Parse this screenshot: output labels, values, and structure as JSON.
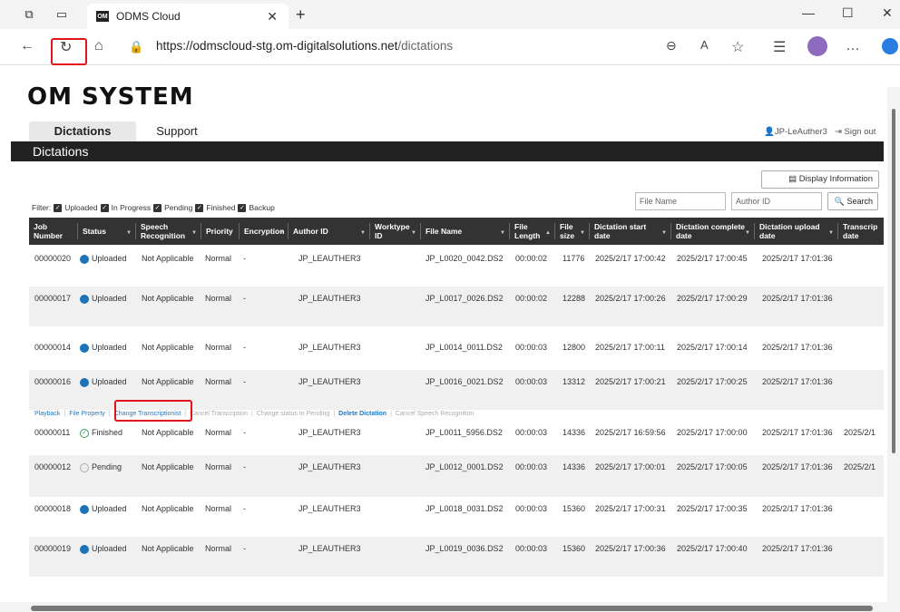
{
  "browser": {
    "tab_title": "ODMS Cloud",
    "favicon_text": "OM",
    "url_host": "https://odmscloud-stg.om-digitalsolutions.net",
    "url_path": "/dictations"
  },
  "app": {
    "logo": "OM SYSTEM",
    "nav_tabs": [
      "Dictations",
      "Support"
    ],
    "user": "JP-LeAuther3",
    "sign_out": "Sign out",
    "section_title": "Dictations",
    "display_info_label": "Display Information",
    "filter_label": "Filter:",
    "filters": [
      "Uploaded",
      "In Progress",
      "Pending",
      "Finished",
      "Backup"
    ],
    "file_name_placeholder": "File Name",
    "author_id_placeholder": "Author ID",
    "search_label": "Search"
  },
  "table": {
    "columns": [
      "Job Number",
      "Status",
      "Speech Recognition",
      "Priority",
      "Encryption",
      "Author ID",
      "Worktype ID",
      "File Name",
      "File Length",
      "File size",
      "Dictation start date",
      "Dictation complete date",
      "Dictation upload date",
      "Transcrip date"
    ],
    "rows": [
      {
        "job": "00000020",
        "status": "Uploaded",
        "speech": "Not Applicable",
        "priority": "Normal",
        "enc": "-",
        "author": "JP_LEAUTHER3",
        "worktype": "",
        "file": "JP_L0020_0042.DS2",
        "length": "00:00:02",
        "size": "11776",
        "start": "2025/2/17 17:00:42",
        "complete": "2025/2/17 17:00:45",
        "upload": "2025/2/17 17:01:36",
        "trans": ""
      },
      {
        "job": "00000017",
        "status": "Uploaded",
        "speech": "Not Applicable",
        "priority": "Normal",
        "enc": "-",
        "author": "JP_LEAUTHER3",
        "worktype": "",
        "file": "JP_L0017_0026.DS2",
        "length": "00:00:02",
        "size": "12288",
        "start": "2025/2/17 17:00:26",
        "complete": "2025/2/17 17:00:29",
        "upload": "2025/2/17 17:01:36",
        "trans": ""
      },
      {
        "job": "00000014",
        "status": "Uploaded",
        "speech": "Not Applicable",
        "priority": "Normal",
        "enc": "-",
        "author": "JP_LEAUTHER3",
        "worktype": "",
        "file": "JP_L0014_0011.DS2",
        "length": "00:00:03",
        "size": "12800",
        "start": "2025/2/17 17:00:11",
        "complete": "2025/2/17 17:00:14",
        "upload": "2025/2/17 17:01:36",
        "trans": ""
      },
      {
        "job": "00000016",
        "status": "Uploaded",
        "speech": "Not Applicable",
        "priority": "Normal",
        "enc": "-",
        "author": "JP_LEAUTHER3",
        "worktype": "",
        "file": "JP_L0016_0021.DS2",
        "length": "00:00:03",
        "size": "13312",
        "start": "2025/2/17 17:00:21",
        "complete": "2025/2/17 17:00:25",
        "upload": "2025/2/17 17:01:36",
        "trans": ""
      },
      {
        "job": "00000011",
        "status": "Finished",
        "speech": "Not Applicable",
        "priority": "Normal",
        "enc": "-",
        "author": "JP_LEAUTHER3",
        "worktype": "",
        "file": "JP_L0011_5956.DS2",
        "length": "00:00:03",
        "size": "14336",
        "start": "2025/2/17 16:59:56",
        "complete": "2025/2/17 17:00:00",
        "upload": "2025/2/17 17:01:36",
        "trans": "2025/2/1"
      },
      {
        "job": "00000012",
        "status": "Pending",
        "speech": "Not Applicable",
        "priority": "Normal",
        "enc": "-",
        "author": "JP_LEAUTHER3",
        "worktype": "",
        "file": "JP_L0012_0001.DS2",
        "length": "00:00:03",
        "size": "14336",
        "start": "2025/2/17 17:00:01",
        "complete": "2025/2/17 17:00:05",
        "upload": "2025/2/17 17:01:36",
        "trans": "2025/2/1"
      },
      {
        "job": "00000018",
        "status": "Uploaded",
        "speech": "Not Applicable",
        "priority": "Normal",
        "enc": "-",
        "author": "JP_LEAUTHER3",
        "worktype": "",
        "file": "JP_L0018_0031.DS2",
        "length": "00:00:03",
        "size": "15360",
        "start": "2025/2/17 17:00:31",
        "complete": "2025/2/17 17:00:35",
        "upload": "2025/2/17 17:01:36",
        "trans": ""
      },
      {
        "job": "00000019",
        "status": "Uploaded",
        "speech": "Not Applicable",
        "priority": "Normal",
        "enc": "-",
        "author": "JP_LEAUTHER3",
        "worktype": "",
        "file": "JP_L0019_0036.DS2",
        "length": "00:00:03",
        "size": "15360",
        "start": "2025/2/17 17:00:36",
        "complete": "2025/2/17 17:00:40",
        "upload": "2025/2/17 17:01:36",
        "trans": ""
      }
    ],
    "actions": [
      {
        "label": "Playback",
        "enabled": true
      },
      {
        "label": "File Property",
        "enabled": true
      },
      {
        "label": "Change Transcriptionist",
        "enabled": true
      },
      {
        "label": "Cancel Transcription",
        "enabled": false
      },
      {
        "label": "Change status to Pending",
        "enabled": false
      },
      {
        "label": "Delete Dictation",
        "enabled": true
      },
      {
        "label": "Cancel Speech Recognition",
        "enabled": false
      }
    ]
  },
  "colors": {
    "uploaded": "#1b73ba",
    "finished": "#3aa25a",
    "highlight": "#e0141a"
  }
}
